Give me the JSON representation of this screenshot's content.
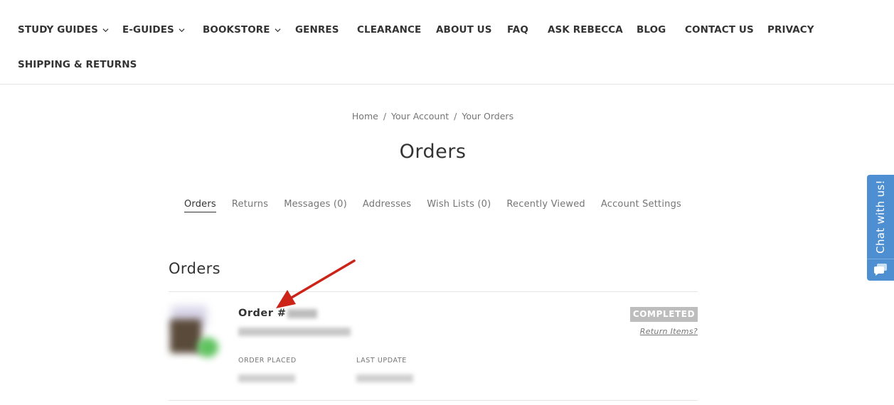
{
  "nav": {
    "items": [
      {
        "label": "STUDY GUIDES",
        "dropdown": true
      },
      {
        "label": "E-GUIDES",
        "dropdown": true
      },
      {
        "label": "BOOKSTORE",
        "dropdown": true
      },
      {
        "label": "GENRES",
        "dropdown": false
      },
      {
        "label": "CLEARANCE",
        "dropdown": false
      },
      {
        "label": "ABOUT US",
        "dropdown": false
      },
      {
        "label": "FAQ",
        "dropdown": false
      },
      {
        "label": "ASK REBECCA",
        "dropdown": false
      },
      {
        "label": "BLOG",
        "dropdown": false
      },
      {
        "label": "CONTACT US",
        "dropdown": false
      },
      {
        "label": "PRIVACY",
        "dropdown": false
      },
      {
        "label": "SHIPPING & RETURNS",
        "dropdown": false
      }
    ]
  },
  "breadcrumb": {
    "items": [
      "Home",
      "Your Account",
      "Your Orders"
    ],
    "separator": "/"
  },
  "page": {
    "title": "Orders"
  },
  "tabs": [
    {
      "label": "Orders",
      "active": true
    },
    {
      "label": "Returns",
      "active": false
    },
    {
      "label": "Messages (0)",
      "active": false
    },
    {
      "label": "Addresses",
      "active": false
    },
    {
      "label": "Wish Lists (0)",
      "active": false
    },
    {
      "label": "Recently Viewed",
      "active": false
    },
    {
      "label": "Account Settings",
      "active": false
    }
  ],
  "orders_section": {
    "title": "Orders",
    "order": {
      "title_prefix": "Order #",
      "status": "COMPLETED",
      "return_link": "Return Items?",
      "placed_label": "ORDER PLACED",
      "updated_label": "LAST UPDATE"
    }
  },
  "chat": {
    "label": "Chat with us!",
    "icon": "chat-bubbles-icon"
  },
  "colors": {
    "text": "#333333",
    "muted": "#757575",
    "badge_bg": "#bdbdbd",
    "chat_bg": "#4d8fd1",
    "arrow": "#cc2418"
  }
}
